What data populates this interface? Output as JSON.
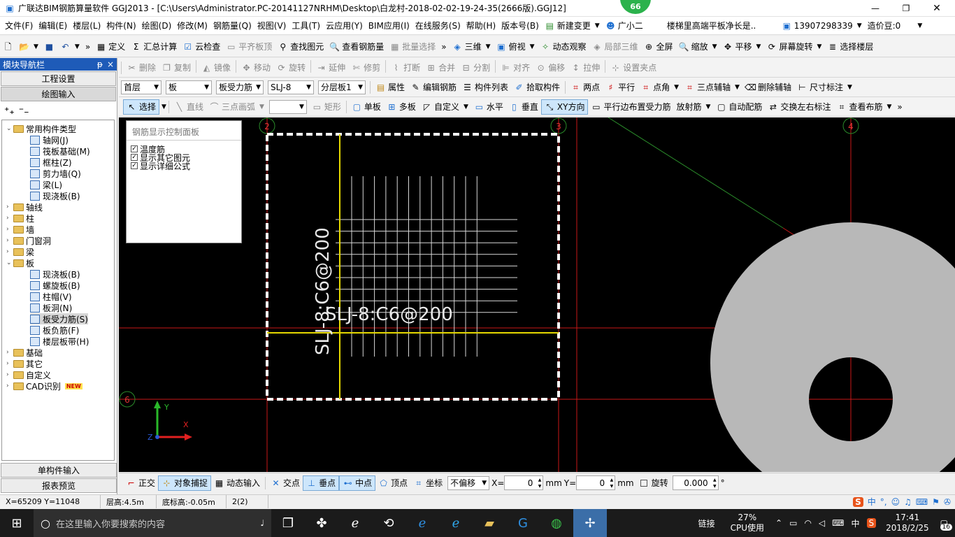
{
  "window": {
    "title": "广联达BIM钢筋算量软件 GGJ2013 - [C:\\Users\\Administrator.PC-20141127NRHM\\Desktop\\白龙村-2018-02-02-19-24-35(2666版).GGJ12]",
    "badge": "66",
    "minimize": "—",
    "maximize": "❐",
    "close": "✕"
  },
  "menubar": {
    "items": [
      "文件(F)",
      "编辑(E)",
      "楼层(L)",
      "构件(N)",
      "绘图(D)",
      "修改(M)",
      "钢筋量(Q)",
      "视图(V)",
      "工具(T)",
      "云应用(Y)",
      "BIM应用(I)",
      "在线服务(S)",
      "帮助(H)",
      "版本号(B)"
    ],
    "new_change": "新建变更",
    "assistant": "广小二",
    "notice": "楼梯里高端平板净长是..",
    "phone": "13907298339",
    "cost_bean": "造价豆:0"
  },
  "toolbar1": {
    "define": "定义",
    "sum_calc": "汇总计算",
    "cloud_check": "云检查",
    "align_top": "平齐板顶",
    "find_elem": "查找图元",
    "view_rebar": "查看钢筋量",
    "batch_select": "批量选择",
    "three_d": "三维",
    "top_view": "俯视",
    "dynamic_view": "动态观察",
    "local_3d": "局部三维",
    "fullscreen": "全屏",
    "zoom": "缩放",
    "pan": "平移",
    "rotate_screen": "屏幕旋转",
    "select_floor": "选择楼层"
  },
  "toolbar2": {
    "items": [
      "删除",
      "复制",
      "镜像",
      "移动",
      "旋转",
      "延伸",
      "修剪",
      "打断",
      "合并",
      "分割",
      "对齐",
      "偏移",
      "拉伸",
      "设置夹点"
    ]
  },
  "toolbar3": {
    "floor": "首层",
    "category": "板",
    "type": "板受力筋",
    "name": "SLJ-8",
    "layer": "分层板1",
    "attributes": "属性",
    "edit_rebar": "编辑钢筋",
    "elem_list": "构件列表",
    "pick_elem": "拾取构件",
    "two_points": "两点",
    "parallel": "平行",
    "point_angle": "点角",
    "three_point_axis": "三点辅轴",
    "delete_axis": "删除辅轴",
    "dimension": "尺寸标注"
  },
  "toolbar4": {
    "select": "选择",
    "line": "直线",
    "arc": "三点画弧",
    "rect": "矩形",
    "single_board": "单板",
    "multi_board": "多板",
    "custom": "自定义",
    "horizontal": "水平",
    "vertical": "垂直",
    "xy_dir": "XY方向",
    "parallel_edge": "平行边布置受力筋",
    "radial": "放射筋",
    "auto_config": "自动配筋",
    "swap_label": "交换左右标注",
    "view_layout": "查看布筋"
  },
  "nav": {
    "title": "模块导航栏",
    "pin": "ᵽ",
    "close": "×",
    "project_settings": "工程设置",
    "drawing_input": "绘图输入",
    "single_input": "单构件输入",
    "report_preview": "报表预览",
    "tree": [
      {
        "label": "常用构件类型",
        "level": 0,
        "toggle": "⌄",
        "kind": "folder"
      },
      {
        "label": "轴网(J)",
        "level": 1,
        "kind": "leaf"
      },
      {
        "label": "筏板基础(M)",
        "level": 1,
        "kind": "leaf"
      },
      {
        "label": "框柱(Z)",
        "level": 1,
        "kind": "leaf"
      },
      {
        "label": "剪力墙(Q)",
        "level": 1,
        "kind": "leaf"
      },
      {
        "label": "梁(L)",
        "level": 1,
        "kind": "leaf"
      },
      {
        "label": "现浇板(B)",
        "level": 1,
        "kind": "leaf"
      },
      {
        "label": "轴线",
        "level": 0,
        "toggle": "›",
        "kind": "folder"
      },
      {
        "label": "柱",
        "level": 0,
        "toggle": "›",
        "kind": "folder"
      },
      {
        "label": "墙",
        "level": 0,
        "toggle": "›",
        "kind": "folder"
      },
      {
        "label": "门窗洞",
        "level": 0,
        "toggle": "›",
        "kind": "folder"
      },
      {
        "label": "梁",
        "level": 0,
        "toggle": "›",
        "kind": "folder"
      },
      {
        "label": "板",
        "level": 0,
        "toggle": "⌄",
        "kind": "folder"
      },
      {
        "label": "现浇板(B)",
        "level": 1,
        "kind": "leaf"
      },
      {
        "label": "螺旋板(B)",
        "level": 1,
        "kind": "leaf"
      },
      {
        "label": "柱帽(V)",
        "level": 1,
        "kind": "leaf"
      },
      {
        "label": "板洞(N)",
        "level": 1,
        "kind": "leaf"
      },
      {
        "label": "板受力筋(S)",
        "level": 1,
        "kind": "leaf",
        "selected": true
      },
      {
        "label": "板负筋(F)",
        "level": 1,
        "kind": "leaf"
      },
      {
        "label": "楼层板带(H)",
        "level": 1,
        "kind": "leaf"
      },
      {
        "label": "基础",
        "level": 0,
        "toggle": "›",
        "kind": "folder"
      },
      {
        "label": "其它",
        "level": 0,
        "toggle": "›",
        "kind": "folder"
      },
      {
        "label": "自定义",
        "level": 0,
        "toggle": "›",
        "kind": "folder"
      },
      {
        "label": "CAD识别",
        "level": 0,
        "toggle": "›",
        "kind": "folder",
        "badge": "NEW"
      }
    ]
  },
  "panel": {
    "title": "钢筋显示控制面板",
    "options": [
      {
        "label": "温度筋",
        "checked": true
      },
      {
        "label": "显示其它图元",
        "checked": true
      },
      {
        "label": "显示详细公式",
        "checked": true
      }
    ]
  },
  "canvas": {
    "axis_labels": [
      "2",
      "3",
      "4",
      "6"
    ],
    "rebar_label_h": "SLJ-8:C6@200",
    "rebar_label_v": "SLJ-8:C6@200",
    "coord_y": "Y",
    "coord_x": "X",
    "coord_z": "Z"
  },
  "snapbar": {
    "ortho": "正交",
    "object_snap": "对象捕捉",
    "dynamic_input": "动态输入",
    "intersection": "交点",
    "perpendicular": "垂点",
    "midpoint": "中点",
    "vertex": "顶点",
    "coordinate": "坐标",
    "offset_mode": "不偏移",
    "x_label": "X=",
    "x_value": "0",
    "mm1": "mm",
    "y_label": "Y=",
    "y_value": "0",
    "mm2": "mm",
    "rotate": "旋转",
    "rotate_value": "0.000",
    "degree": "°"
  },
  "status": {
    "coords": "X=65209  Y=11048",
    "floor_height": "层高:4.5m",
    "bottom_height": "底标高:-0.05m",
    "count": "2(2)",
    "ime": "中",
    "ime_dot": "°,"
  },
  "taskbar": {
    "search_placeholder": "在这里输入你要搜索的内容",
    "link": "链接",
    "cpu_pct": "27%",
    "cpu_label": "CPU使用",
    "lang": "中",
    "time": "17:41",
    "date": "2018/2/25",
    "notif": "16"
  }
}
